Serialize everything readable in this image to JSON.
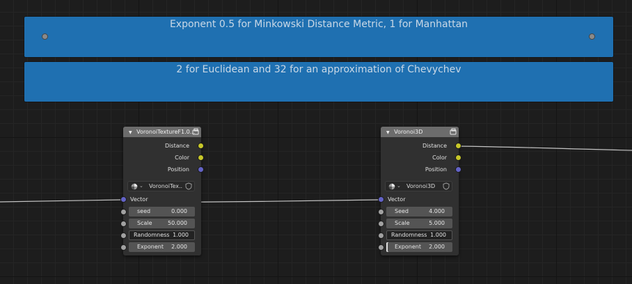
{
  "frames": [
    {
      "text": "Exponent 0.5 for Minkowski Distance Metric, 1 for Manhattan"
    },
    {
      "text": "2 for Euclidean and 32 for an approximation of Chevychev"
    }
  ],
  "nodes": [
    {
      "title": "VoronoiTextureF1.0...",
      "outputs": [
        "Distance",
        "Color",
        "Position"
      ],
      "tree": "VoronoiTex...",
      "vector_label": "Vector",
      "inputs": [
        {
          "label": "seed",
          "value": "0.000"
        },
        {
          "label": "Scale",
          "value": "50.000"
        },
        {
          "label": "Randomness",
          "value": "1.000"
        },
        {
          "label": "Exponent",
          "value": "2.000"
        }
      ]
    },
    {
      "title": "Voronoi3D",
      "outputs": [
        "Distance",
        "Color",
        "Position"
      ],
      "tree": "Voronoi3D",
      "vector_label": "Vector",
      "inputs": [
        {
          "label": "Seed",
          "value": "4.000"
        },
        {
          "label": "Scale",
          "value": "5.000"
        },
        {
          "label": "Randomness",
          "value": "1.000"
        },
        {
          "label": "Exponent",
          "value": "2.000"
        }
      ]
    }
  ],
  "colors": {
    "frame": "#1f70b1",
    "socket_float": "#a1a1a1",
    "socket_color": "#c7c729",
    "socket_vector": "#6363c7",
    "node_header": "#6c6c6c"
  },
  "icons": [
    "collapse-arrow-icon",
    "node-group-icon",
    "sphere-icon",
    "chevron-down-icon",
    "fake-user-shield-icon"
  ]
}
